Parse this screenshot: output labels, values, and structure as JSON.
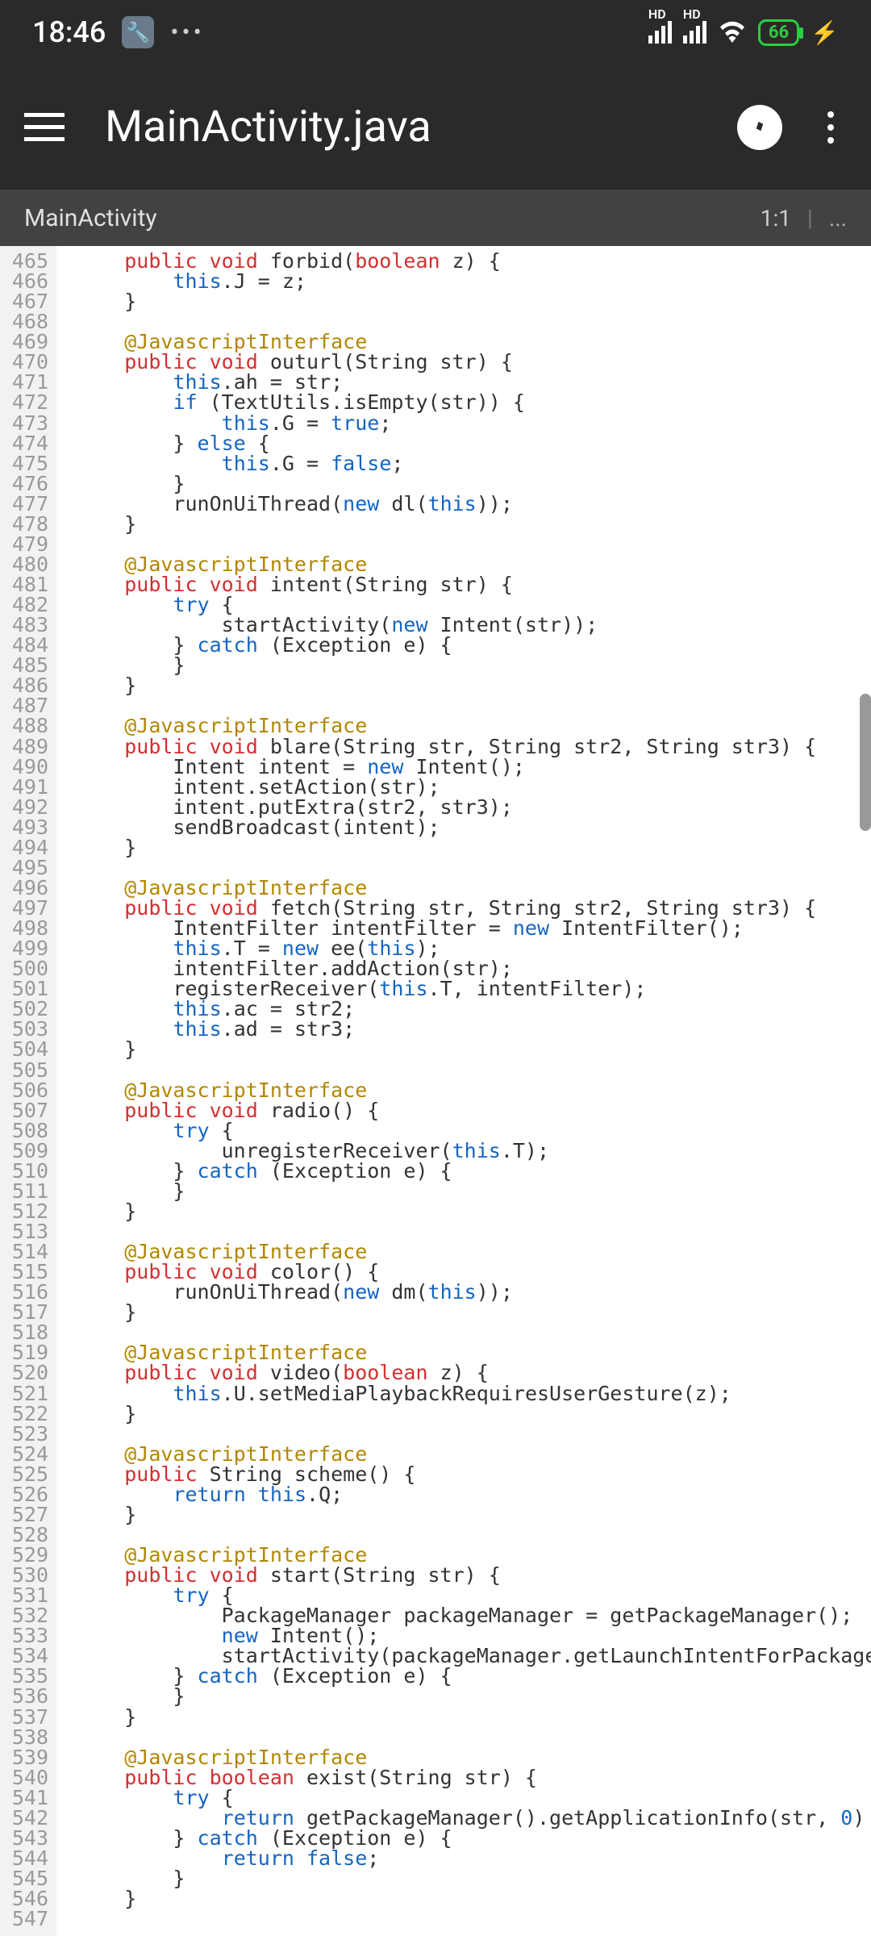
{
  "status": {
    "time": "18:46",
    "settings_icon": "🔧",
    "battery": "66",
    "signal_label": "HD"
  },
  "appbar": {
    "title": "MainActivity.java"
  },
  "crumb": {
    "path": "MainActivity",
    "cursor": "1:1",
    "more": "..."
  },
  "editor": {
    "first_line": 465,
    "last_line": 547,
    "lines": [
      [
        [
          "kw-access",
          "public "
        ],
        [
          "kw-type",
          "void "
        ],
        [
          "ident",
          "forbid("
        ],
        [
          "kw-type",
          "boolean "
        ],
        [
          "ident",
          "z) {"
        ]
      ],
      [
        [
          "ident",
          "    "
        ],
        [
          "this-ref",
          "this"
        ],
        [
          "ident",
          ".J = z;"
        ]
      ],
      [
        [
          "ident",
          "}"
        ]
      ],
      [],
      [
        [
          "anno",
          "@JavascriptInterface"
        ]
      ],
      [
        [
          "kw-access",
          "public "
        ],
        [
          "kw-type",
          "void "
        ],
        [
          "ident",
          "outurl(String str) {"
        ]
      ],
      [
        [
          "ident",
          "    "
        ],
        [
          "this-ref",
          "this"
        ],
        [
          "ident",
          ".ah = str;"
        ]
      ],
      [
        [
          "ident",
          "    "
        ],
        [
          "kw-flow",
          "if "
        ],
        [
          "ident",
          "(TextUtils.isEmpty(str)) {"
        ]
      ],
      [
        [
          "ident",
          "        "
        ],
        [
          "this-ref",
          "this"
        ],
        [
          "ident",
          ".G = "
        ],
        [
          "kw-bool",
          "true"
        ],
        [
          "ident",
          ";"
        ]
      ],
      [
        [
          "ident",
          "    } "
        ],
        [
          "kw-flow",
          "else "
        ],
        [
          "ident",
          "{"
        ]
      ],
      [
        [
          "ident",
          "        "
        ],
        [
          "this-ref",
          "this"
        ],
        [
          "ident",
          ".G = "
        ],
        [
          "kw-bool",
          "false"
        ],
        [
          "ident",
          ";"
        ]
      ],
      [
        [
          "ident",
          "    }"
        ]
      ],
      [
        [
          "ident",
          "    runOnUiThread("
        ],
        [
          "kw-flow",
          "new "
        ],
        [
          "ident",
          "dl("
        ],
        [
          "this-ref",
          "this"
        ],
        [
          "ident",
          "));"
        ]
      ],
      [
        [
          "ident",
          "}"
        ]
      ],
      [],
      [
        [
          "anno",
          "@JavascriptInterface"
        ]
      ],
      [
        [
          "kw-access",
          "public "
        ],
        [
          "kw-type",
          "void "
        ],
        [
          "ident",
          "intent(String str) {"
        ]
      ],
      [
        [
          "ident",
          "    "
        ],
        [
          "kw-flow",
          "try "
        ],
        [
          "ident",
          "{"
        ]
      ],
      [
        [
          "ident",
          "        startActivity("
        ],
        [
          "kw-flow",
          "new "
        ],
        [
          "ident",
          "Intent(str));"
        ]
      ],
      [
        [
          "ident",
          "    } "
        ],
        [
          "kw-flow",
          "catch "
        ],
        [
          "ident",
          "(Exception e) {"
        ]
      ],
      [
        [
          "ident",
          "    }"
        ]
      ],
      [
        [
          "ident",
          "}"
        ]
      ],
      [],
      [
        [
          "anno",
          "@JavascriptInterface"
        ]
      ],
      [
        [
          "kw-access",
          "public "
        ],
        [
          "kw-type",
          "void "
        ],
        [
          "ident",
          "blare(String str, String str2, String str3) {"
        ]
      ],
      [
        [
          "ident",
          "    Intent intent = "
        ],
        [
          "kw-flow",
          "new "
        ],
        [
          "ident",
          "Intent();"
        ]
      ],
      [
        [
          "ident",
          "    intent.setAction(str);"
        ]
      ],
      [
        [
          "ident",
          "    intent.putExtra(str2, str3);"
        ]
      ],
      [
        [
          "ident",
          "    sendBroadcast(intent);"
        ]
      ],
      [
        [
          "ident",
          "}"
        ]
      ],
      [],
      [
        [
          "anno",
          "@JavascriptInterface"
        ]
      ],
      [
        [
          "kw-access",
          "public "
        ],
        [
          "kw-type",
          "void "
        ],
        [
          "ident",
          "fetch(String str, String str2, String str3) {"
        ]
      ],
      [
        [
          "ident",
          "    IntentFilter intentFilter = "
        ],
        [
          "kw-flow",
          "new "
        ],
        [
          "ident",
          "IntentFilter();"
        ]
      ],
      [
        [
          "ident",
          "    "
        ],
        [
          "this-ref",
          "this"
        ],
        [
          "ident",
          ".T = "
        ],
        [
          "kw-flow",
          "new "
        ],
        [
          "ident",
          "ee("
        ],
        [
          "this-ref",
          "this"
        ],
        [
          "ident",
          ");"
        ]
      ],
      [
        [
          "ident",
          "    intentFilter.addAction(str);"
        ]
      ],
      [
        [
          "ident",
          "    registerReceiver("
        ],
        [
          "this-ref",
          "this"
        ],
        [
          "ident",
          ".T, intentFilter);"
        ]
      ],
      [
        [
          "ident",
          "    "
        ],
        [
          "this-ref",
          "this"
        ],
        [
          "ident",
          ".ac = str2;"
        ]
      ],
      [
        [
          "ident",
          "    "
        ],
        [
          "this-ref",
          "this"
        ],
        [
          "ident",
          ".ad = str3;"
        ]
      ],
      [
        [
          "ident",
          "}"
        ]
      ],
      [],
      [
        [
          "anno",
          "@JavascriptInterface"
        ]
      ],
      [
        [
          "kw-access",
          "public "
        ],
        [
          "kw-type",
          "void "
        ],
        [
          "ident",
          "radio() {"
        ]
      ],
      [
        [
          "ident",
          "    "
        ],
        [
          "kw-flow",
          "try "
        ],
        [
          "ident",
          "{"
        ]
      ],
      [
        [
          "ident",
          "        unregisterReceiver("
        ],
        [
          "this-ref",
          "this"
        ],
        [
          "ident",
          ".T);"
        ]
      ],
      [
        [
          "ident",
          "    } "
        ],
        [
          "kw-flow",
          "catch "
        ],
        [
          "ident",
          "(Exception e) {"
        ]
      ],
      [
        [
          "ident",
          "    }"
        ]
      ],
      [
        [
          "ident",
          "}"
        ]
      ],
      [],
      [
        [
          "anno",
          "@JavascriptInterface"
        ]
      ],
      [
        [
          "kw-access",
          "public "
        ],
        [
          "kw-type",
          "void "
        ],
        [
          "ident",
          "color() {"
        ]
      ],
      [
        [
          "ident",
          "    runOnUiThread("
        ],
        [
          "kw-flow",
          "new "
        ],
        [
          "ident",
          "dm("
        ],
        [
          "this-ref",
          "this"
        ],
        [
          "ident",
          "));"
        ]
      ],
      [
        [
          "ident",
          "}"
        ]
      ],
      [],
      [
        [
          "anno",
          "@JavascriptInterface"
        ]
      ],
      [
        [
          "kw-access",
          "public "
        ],
        [
          "kw-type",
          "void "
        ],
        [
          "ident",
          "video("
        ],
        [
          "kw-type",
          "boolean "
        ],
        [
          "ident",
          "z) {"
        ]
      ],
      [
        [
          "ident",
          "    "
        ],
        [
          "this-ref",
          "this"
        ],
        [
          "ident",
          ".U.setMediaPlaybackRequiresUserGesture(z);"
        ]
      ],
      [
        [
          "ident",
          "}"
        ]
      ],
      [],
      [
        [
          "anno",
          "@JavascriptInterface"
        ]
      ],
      [
        [
          "kw-access",
          "public "
        ],
        [
          "ident",
          "String scheme() {"
        ]
      ],
      [
        [
          "ident",
          "    "
        ],
        [
          "kw-flow",
          "return "
        ],
        [
          "this-ref",
          "this"
        ],
        [
          "ident",
          ".Q;"
        ]
      ],
      [
        [
          "ident",
          "}"
        ]
      ],
      [],
      [
        [
          "anno",
          "@JavascriptInterface"
        ]
      ],
      [
        [
          "kw-access",
          "public "
        ],
        [
          "kw-type",
          "void "
        ],
        [
          "ident",
          "start(String str) {"
        ]
      ],
      [
        [
          "ident",
          "    "
        ],
        [
          "kw-flow",
          "try "
        ],
        [
          "ident",
          "{"
        ]
      ],
      [
        [
          "ident",
          "        PackageManager packageManager = getPackageManager();"
        ]
      ],
      [
        [
          "ident",
          "        "
        ],
        [
          "kw-flow",
          "new "
        ],
        [
          "ident",
          "Intent();"
        ]
      ],
      [
        [
          "ident",
          "        startActivity(packageManager.getLaunchIntentForPackage(str));"
        ]
      ],
      [
        [
          "ident",
          "    } "
        ],
        [
          "kw-flow",
          "catch "
        ],
        [
          "ident",
          "(Exception e) {"
        ]
      ],
      [
        [
          "ident",
          "    }"
        ]
      ],
      [
        [
          "ident",
          "}"
        ]
      ],
      [],
      [
        [
          "anno",
          "@JavascriptInterface"
        ]
      ],
      [
        [
          "kw-access",
          "public "
        ],
        [
          "kw-type",
          "boolean "
        ],
        [
          "ident",
          "exist(String str) {"
        ]
      ],
      [
        [
          "ident",
          "    "
        ],
        [
          "kw-flow",
          "try "
        ],
        [
          "ident",
          "{"
        ]
      ],
      [
        [
          "ident",
          "        "
        ],
        [
          "kw-flow",
          "return "
        ],
        [
          "ident",
          "getPackageManager().getApplicationInfo(str, "
        ],
        [
          "kw-num",
          "0"
        ],
        [
          "ident",
          ") != "
        ],
        [
          "kw-bool",
          "null"
        ],
        [
          "ident",
          ";"
        ]
      ],
      [
        [
          "ident",
          "    } "
        ],
        [
          "kw-flow",
          "catch "
        ],
        [
          "ident",
          "(Exception e) {"
        ]
      ],
      [
        [
          "ident",
          "        "
        ],
        [
          "kw-flow",
          "return "
        ],
        [
          "kw-bool",
          "false"
        ],
        [
          "ident",
          ";"
        ]
      ],
      [
        [
          "ident",
          "    }"
        ]
      ],
      [
        [
          "ident",
          "}"
        ]
      ],
      []
    ]
  }
}
